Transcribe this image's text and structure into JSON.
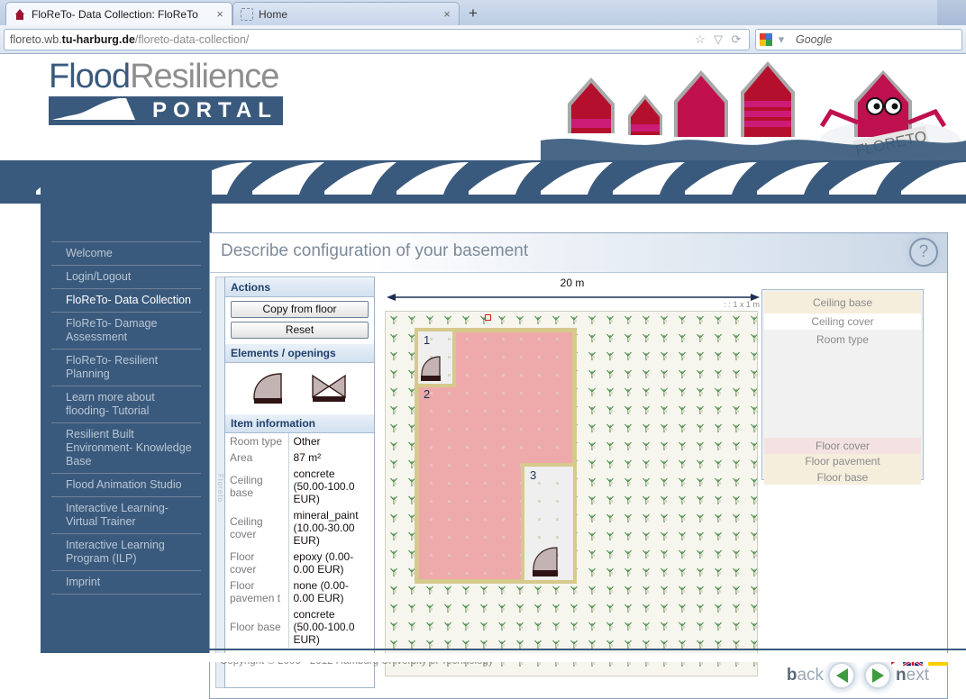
{
  "browser": {
    "tabs": [
      {
        "title": "FloReTo- Data Collection: FloReTo",
        "close": "×",
        "active": true
      },
      {
        "title": "Home",
        "close": "×",
        "active": false
      }
    ],
    "new_tab_label": "+",
    "url": {
      "prefix": "floreto.wb.",
      "host": "tu-harburg.de",
      "path": "/floreto-data-collection/"
    },
    "bookmark_icon": "☆",
    "dropdown_icon": "▽",
    "reload_icon": "⟳",
    "search_engine": "Google",
    "search_caret": "▾"
  },
  "header": {
    "logo_flood": "Flood",
    "logo_resilience": "Resilience",
    "logo_portal": "PORTAL",
    "mascot_label": "FLORETO"
  },
  "sidebar": {
    "items": [
      {
        "label": "Welcome",
        "active": false
      },
      {
        "label": "Login/Logout",
        "active": false
      },
      {
        "label": "FloReTo- Data Collection",
        "active": true
      },
      {
        "label": "FloReTo- Damage Assessment",
        "active": false
      },
      {
        "label": "FloReTo- Resilient Planning",
        "active": false
      },
      {
        "label": "Learn more about flooding- Tutorial",
        "active": false
      },
      {
        "label": "Resilient Built Environment- Knowledge Base",
        "active": false
      },
      {
        "label": "Flood Animation Studio",
        "active": false
      },
      {
        "label": "Interactive Learning- Virtual Trainer",
        "active": false
      },
      {
        "label": "Interactive Learning Program (ILP)",
        "active": false
      },
      {
        "label": "Imprint",
        "active": false
      }
    ]
  },
  "content": {
    "title": "Describe configuration of your basement",
    "help_icon": "?",
    "side_tab_label": "Floreto"
  },
  "toolpanel": {
    "actions_title": "Actions",
    "copy_button": "Copy from floor",
    "reset_button": "Reset",
    "elements_title": "Elements / openings",
    "element_icons": [
      "door-quarter-circle-icon",
      "double-door-icon"
    ],
    "item_info_title": "Item information",
    "item_info_rows": [
      {
        "key": "Room type",
        "value": "Other"
      },
      {
        "key": "Area",
        "value": "87 m²"
      },
      {
        "key": "Ceiling base",
        "value": "concrete (50.00-100.0 EUR)"
      },
      {
        "key": "Ceiling cover",
        "value": "mineral_paint (10.00-30.00 EUR)"
      },
      {
        "key": "Floor cover",
        "value": "epoxy (0.00-0.00 EUR)"
      },
      {
        "key": "Floor pavemen t",
        "value": "none (0.00-0.00 EUR)"
      },
      {
        "key": "Floor base",
        "value": "concrete (50.00-100.0 EUR)"
      }
    ]
  },
  "canvas": {
    "dimension_label": "20 m",
    "scale_label": ": : 1 x 1 m",
    "room_labels": [
      "1",
      "2",
      "3"
    ],
    "colors": {
      "grid_bg": "#f6f5ee",
      "room_fill_pink": "#eeaaaa",
      "room_fill_grey": "#efefef",
      "wall": "#d6c98c",
      "door_fill": "#c3b3b3",
      "door_sill": "#2e1414",
      "marker_outline": "#cc2222"
    }
  },
  "legend": {
    "rows": [
      {
        "label": "Ceiling base",
        "bg": "#f6eedd"
      },
      {
        "label": "Ceiling cover",
        "bg": "#ffffff"
      },
      {
        "label": "Room type",
        "bg": "#f1f1f1"
      },
      {
        "label": "Floor cover",
        "bg": "#f4e2e2"
      },
      {
        "label": "Floor pavement",
        "bg": "#f6eedd"
      },
      {
        "label": "Floor base",
        "bg": "#f6eedd"
      }
    ]
  },
  "bottom_nav": {
    "back_bold": "b",
    "back_rest": "ack",
    "next_bold": "n",
    "next_rest": "ext",
    "back_icon": "triangle-left-icon",
    "next_icon": "triangle-right-icon"
  },
  "footer": {
    "copyright": "Copyright © 2006 - 2012 Hamburg University of Technology",
    "flags": [
      "uk-flag-icon",
      "germany-flag-icon"
    ]
  }
}
